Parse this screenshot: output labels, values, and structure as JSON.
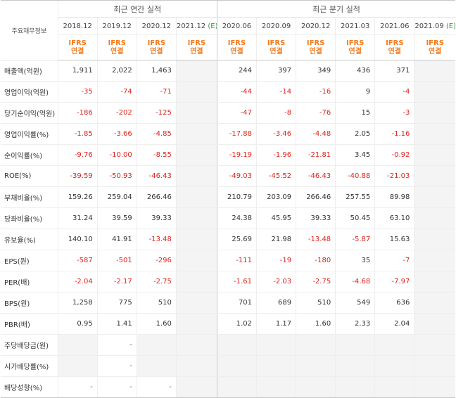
{
  "header": {
    "corner_label": "주요재무정보",
    "annual_label": "최근 연간 실적",
    "quarter_label": "최근 분기 실적",
    "periods": [
      {
        "label": "2018.12",
        "estimate": ""
      },
      {
        "label": "2019.12",
        "estimate": ""
      },
      {
        "label": "2020.12",
        "estimate": ""
      },
      {
        "label": "2021.12",
        "estimate": "(E)"
      },
      {
        "label": "2020.06",
        "estimate": ""
      },
      {
        "label": "2020.09",
        "estimate": ""
      },
      {
        "label": "2020.12",
        "estimate": ""
      },
      {
        "label": "2021.03",
        "estimate": ""
      },
      {
        "label": "2021.06",
        "estimate": ""
      },
      {
        "label": "2021.09",
        "estimate": "(E)"
      }
    ],
    "ifrs_line1": "IFRS",
    "ifrs_line2": "연결"
  },
  "rows": [
    {
      "label": "매출액(억원)",
      "values": [
        "1,911",
        "2,022",
        "1,463",
        "",
        "244",
        "397",
        "349",
        "436",
        "371",
        ""
      ]
    },
    {
      "label": "영업이익(억원)",
      "values": [
        "-35",
        "-74",
        "-71",
        "",
        "-44",
        "-14",
        "-16",
        "9",
        "-4",
        ""
      ]
    },
    {
      "label": "당기순이익(억원)",
      "values": [
        "-186",
        "-202",
        "-125",
        "",
        "-47",
        "-8",
        "-76",
        "15",
        "-3",
        ""
      ]
    },
    {
      "label": "영업이익률(%)",
      "values": [
        "-1.85",
        "-3.66",
        "-4.85",
        "",
        "-17.88",
        "-3.46",
        "-4.48",
        "2.05",
        "-1.16",
        ""
      ]
    },
    {
      "label": "순이익률(%)",
      "values": [
        "-9.76",
        "-10.00",
        "-8.55",
        "",
        "-19.19",
        "-1.96",
        "-21.81",
        "3.45",
        "-0.92",
        ""
      ]
    },
    {
      "label": "ROE(%)",
      "values": [
        "-39.59",
        "-50.93",
        "-46.43",
        "",
        "-49.03",
        "-45.52",
        "-46.43",
        "-40.88",
        "-21.03",
        ""
      ]
    },
    {
      "label": "부채비율(%)",
      "values": [
        "159.26",
        "259.04",
        "266.46",
        "",
        "210.79",
        "203.09",
        "266.46",
        "257.55",
        "89.98",
        ""
      ]
    },
    {
      "label": "당좌비율(%)",
      "values": [
        "31.24",
        "39.59",
        "39.33",
        "",
        "24.38",
        "45.95",
        "39.33",
        "50.45",
        "63.10",
        ""
      ]
    },
    {
      "label": "유보율(%)",
      "values": [
        "140.10",
        "41.91",
        "-13.48",
        "",
        "25.69",
        "21.98",
        "-13.48",
        "-5.87",
        "15.63",
        ""
      ]
    },
    {
      "label": "EPS(원)",
      "values": [
        "-587",
        "-501",
        "-296",
        "",
        "-111",
        "-19",
        "-180",
        "35",
        "-7",
        ""
      ]
    },
    {
      "label": "PER(배)",
      "values": [
        "-2.04",
        "-2.17",
        "-2.75",
        "",
        "-1.61",
        "-2.03",
        "-2.75",
        "-4.68",
        "-7.97",
        ""
      ]
    },
    {
      "label": "BPS(원)",
      "values": [
        "1,258",
        "775",
        "510",
        "",
        "701",
        "689",
        "510",
        "549",
        "636",
        ""
      ]
    },
    {
      "label": "PBR(배)",
      "values": [
        "0.95",
        "1.41",
        "1.60",
        "",
        "1.02",
        "1.17",
        "1.60",
        "2.33",
        "2.04",
        ""
      ]
    },
    {
      "label": "주당배당금(원)",
      "values": [
        "",
        "-",
        "",
        "",
        "",
        "",
        "",
        "",
        "",
        ""
      ]
    },
    {
      "label": "시가배당률(%)",
      "values": [
        "",
        "-",
        "",
        "",
        "",
        "",
        "",
        "",
        "",
        ""
      ]
    },
    {
      "label": "배당성향(%)",
      "values": [
        "-",
        "-",
        "-",
        "",
        "",
        "",
        "",
        "",
        "",
        ""
      ]
    }
  ],
  "colors": {
    "negative": "#e0231b",
    "ifrs": "#f47c20",
    "estimate_mark": "#2e9a3b"
  }
}
